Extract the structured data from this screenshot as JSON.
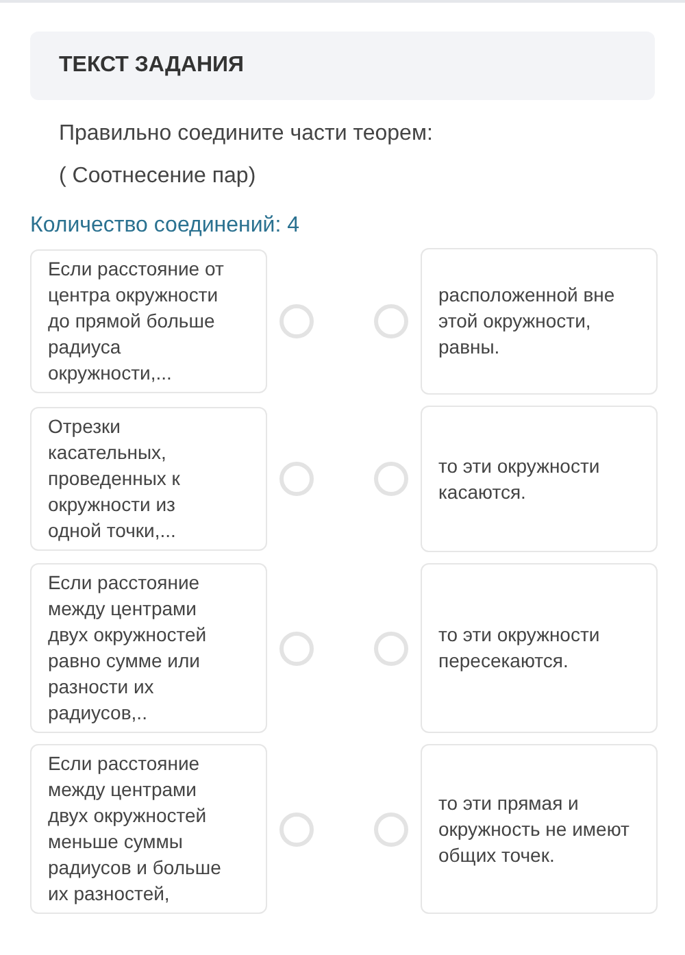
{
  "header": {
    "title": "ТЕКСТ ЗАДАНИЯ"
  },
  "question": {
    "lines": [
      "Правильно соедините части теорем:",
      "( Соотнесение пар)"
    ]
  },
  "connections_count": "Количество соединений: 4",
  "pairs": [
    {
      "left": {
        "text": "Если расстояние от центра окружности до прямой больше радиуса окружности,...",
        "connected": false
      },
      "right": {
        "text": "расположенной вне этой окружности, равны.",
        "connected": false
      }
    },
    {
      "left": {
        "text": "Отрезки касательных, проведенных к окружности из одной точки,...",
        "connected": false
      },
      "right": {
        "text": "то эти окружности касаются.",
        "connected": false
      }
    },
    {
      "left": {
        "text": "Если расстояние между центрами двух окружностей равно сумме или разности их радиусов,..",
        "connected": false
      },
      "right": {
        "text": "то эти окружности пересекаются.",
        "connected": false
      }
    },
    {
      "left": {
        "text": "Если расстояние между центрами двух окружностей меньше суммы радиусов и больше их разностей,",
        "connected": false
      },
      "right": {
        "text": "то эти прямая и окружность не имеют общих точек.",
        "connected": false
      }
    }
  ]
}
